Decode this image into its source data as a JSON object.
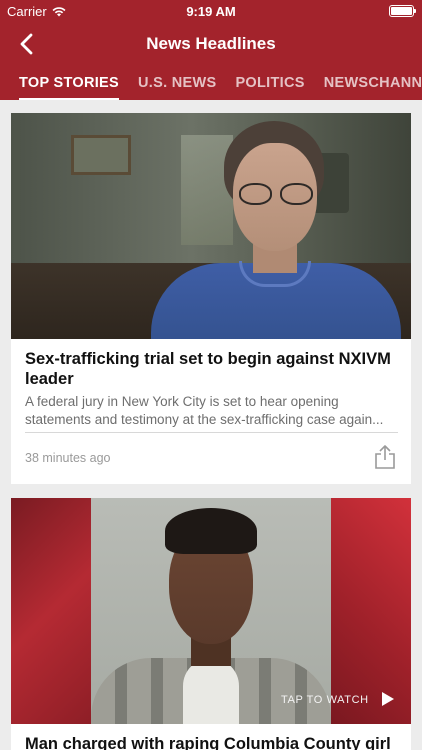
{
  "status_bar": {
    "carrier": "Carrier",
    "time": "9:19 AM"
  },
  "nav": {
    "title": "News Headlines"
  },
  "tabs": [
    {
      "label": "TOP STORIES",
      "active": true
    },
    {
      "label": "U.S. NEWS",
      "active": false
    },
    {
      "label": "POLITICS",
      "active": false
    },
    {
      "label": "NEWSCHANNEL",
      "active": false
    }
  ],
  "articles": [
    {
      "headline": "Sex-trafficking trial set to begin against NXIVM leader",
      "summary": "A federal jury in New York City is set to hear opening statements and testimony at the sex-trafficking case again...",
      "timestamp": "38 minutes ago"
    },
    {
      "headline": "Man charged with raping Columbia County girl",
      "video_cta": "TAP TO WATCH"
    }
  ],
  "colors": {
    "brand": "#a3232c",
    "background": "#ececec"
  }
}
